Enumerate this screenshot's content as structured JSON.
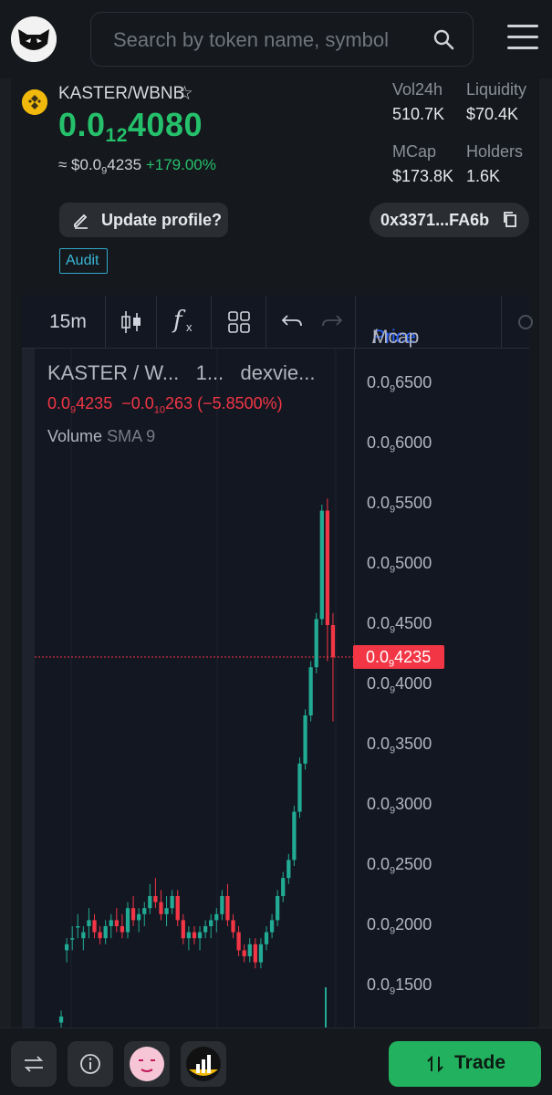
{
  "search": {
    "placeholder": "Search by token name, symbol"
  },
  "token": {
    "pair": "KASTER/WBNB",
    "price_prefix": "0.0",
    "price_zeros": "12",
    "price_digits": "4080",
    "usd_prefix": "≈ $0.0",
    "usd_zeros": "9",
    "usd_digits": "4235",
    "change": "+179.00%"
  },
  "stats": {
    "vol_label": "Vol24h",
    "vol_value": "510.7K",
    "liq_label": "Liquidity",
    "liq_value": "$70.4K",
    "mcap_label": "MCap",
    "mcap_value": "$173.8K",
    "holders_label": "Holders",
    "holders_value": "1.6K"
  },
  "actions": {
    "update_label": "Update profile?",
    "address": "0x3371...FA6b",
    "audit_label": "Audit"
  },
  "chart_toolbar": {
    "interval": "15m",
    "price_label": "Price",
    "slash": " / ",
    "mcap_label": "Mcap"
  },
  "legend": {
    "title": "KASTER / W...",
    "interval": "1...",
    "source": "dexvie...",
    "last_prefix": "0.0",
    "last_zeros": "9",
    "last_digits": "4235",
    "delta_prefix": "−0.0",
    "delta_zeros": "10",
    "delta_digits": "263",
    "delta_pct": "(−5.8500%)",
    "volume_label": "Volume",
    "sma_label": "SMA 9"
  },
  "axis": {
    "ticks": [
      {
        "pre": "0.0",
        "z": "9",
        "d": "6500"
      },
      {
        "pre": "0.0",
        "z": "9",
        "d": "6000"
      },
      {
        "pre": "0.0",
        "z": "9",
        "d": "5500"
      },
      {
        "pre": "0.0",
        "z": "9",
        "d": "5000"
      },
      {
        "pre": "0.0",
        "z": "9",
        "d": "4500"
      },
      {
        "pre": "0.0",
        "z": "9",
        "d": "4000"
      },
      {
        "pre": "0.0",
        "z": "9",
        "d": "3500"
      },
      {
        "pre": "0.0",
        "z": "9",
        "d": "3000"
      },
      {
        "pre": "0.0",
        "z": "9",
        "d": "2500"
      },
      {
        "pre": "0.0",
        "z": "9",
        "d": "2000"
      },
      {
        "pre": "0.0",
        "z": "9",
        "d": "1500"
      }
    ],
    "current": {
      "pre": "0.0",
      "z": "9",
      "d": "4235"
    }
  },
  "chart_data": {
    "type": "candlestick",
    "ylim": [
      0.12,
      0.67
    ],
    "y_unit_note_visible": "0.0₉ subscript price format",
    "current_price": 0.4235,
    "candles": [
      [
        0.12,
        0.13,
        0.11,
        0.125
      ],
      [
        0.18,
        0.19,
        0.17,
        0.185
      ],
      [
        0.19,
        0.2,
        0.18,
        0.19
      ],
      [
        0.2,
        0.21,
        0.19,
        0.2
      ],
      [
        0.19,
        0.2,
        0.18,
        0.195
      ],
      [
        0.2,
        0.215,
        0.19,
        0.205
      ],
      [
        0.205,
        0.21,
        0.19,
        0.195
      ],
      [
        0.195,
        0.2,
        0.185,
        0.19
      ],
      [
        0.19,
        0.205,
        0.185,
        0.2
      ],
      [
        0.2,
        0.21,
        0.19,
        0.205
      ],
      [
        0.205,
        0.215,
        0.195,
        0.2
      ],
      [
        0.2,
        0.21,
        0.19,
        0.195
      ],
      [
        0.195,
        0.22,
        0.19,
        0.215
      ],
      [
        0.215,
        0.225,
        0.2,
        0.205
      ],
      [
        0.205,
        0.215,
        0.195,
        0.21
      ],
      [
        0.21,
        0.22,
        0.2,
        0.215
      ],
      [
        0.215,
        0.235,
        0.21,
        0.225
      ],
      [
        0.225,
        0.24,
        0.215,
        0.22
      ],
      [
        0.22,
        0.23,
        0.205,
        0.21
      ],
      [
        0.21,
        0.225,
        0.2,
        0.215
      ],
      [
        0.215,
        0.23,
        0.21,
        0.225
      ],
      [
        0.225,
        0.23,
        0.2,
        0.205
      ],
      [
        0.205,
        0.21,
        0.185,
        0.19
      ],
      [
        0.19,
        0.2,
        0.18,
        0.195
      ],
      [
        0.195,
        0.2,
        0.185,
        0.19
      ],
      [
        0.19,
        0.2,
        0.18,
        0.195
      ],
      [
        0.195,
        0.205,
        0.19,
        0.2
      ],
      [
        0.2,
        0.21,
        0.19,
        0.205
      ],
      [
        0.205,
        0.215,
        0.195,
        0.21
      ],
      [
        0.21,
        0.23,
        0.205,
        0.225
      ],
      [
        0.225,
        0.235,
        0.2,
        0.205
      ],
      [
        0.205,
        0.21,
        0.19,
        0.195
      ],
      [
        0.195,
        0.2,
        0.175,
        0.18
      ],
      [
        0.18,
        0.185,
        0.17,
        0.175
      ],
      [
        0.175,
        0.19,
        0.17,
        0.185
      ],
      [
        0.185,
        0.19,
        0.165,
        0.17
      ],
      [
        0.17,
        0.19,
        0.165,
        0.185
      ],
      [
        0.185,
        0.2,
        0.18,
        0.195
      ],
      [
        0.195,
        0.21,
        0.19,
        0.205
      ],
      [
        0.205,
        0.23,
        0.2,
        0.225
      ],
      [
        0.225,
        0.245,
        0.22,
        0.24
      ],
      [
        0.24,
        0.26,
        0.235,
        0.255
      ],
      [
        0.255,
        0.3,
        0.25,
        0.295
      ],
      [
        0.295,
        0.34,
        0.29,
        0.335
      ],
      [
        0.335,
        0.38,
        0.33,
        0.375
      ],
      [
        0.375,
        0.42,
        0.37,
        0.415
      ],
      [
        0.415,
        0.46,
        0.41,
        0.455
      ],
      [
        0.455,
        0.55,
        0.45,
        0.545
      ],
      [
        0.545,
        0.555,
        0.42,
        0.45
      ],
      [
        0.45,
        0.46,
        0.37,
        0.4235
      ]
    ]
  }
}
